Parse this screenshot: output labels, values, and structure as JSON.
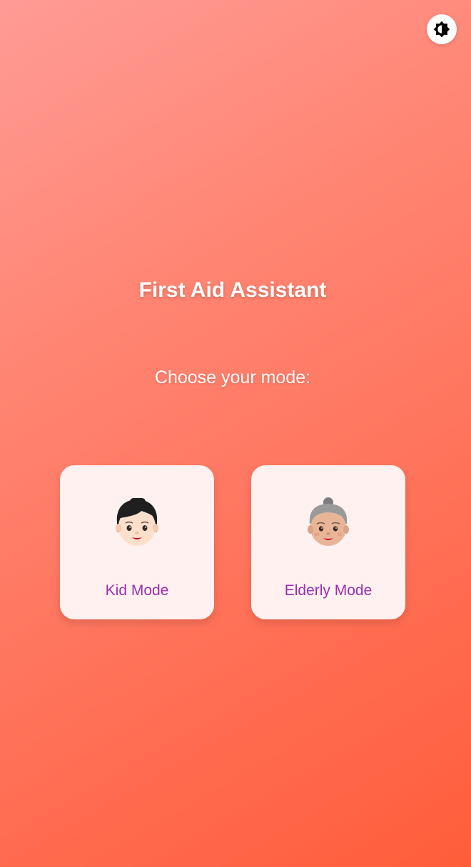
{
  "app": {
    "title": "First Aid Assistant",
    "subtitle": "Choose your mode:"
  },
  "theme_toggle": {
    "icon": "brightness-icon"
  },
  "modes": [
    {
      "label": "Kid Mode",
      "icon": "child-face-icon"
    },
    {
      "label": "Elderly Mode",
      "icon": "older-woman-face-icon"
    }
  ],
  "colors": {
    "label": "#9c2fb0",
    "card": "#fff1ef",
    "gradient_start": "#ff9b95",
    "gradient_end": "#ff5d3a"
  }
}
